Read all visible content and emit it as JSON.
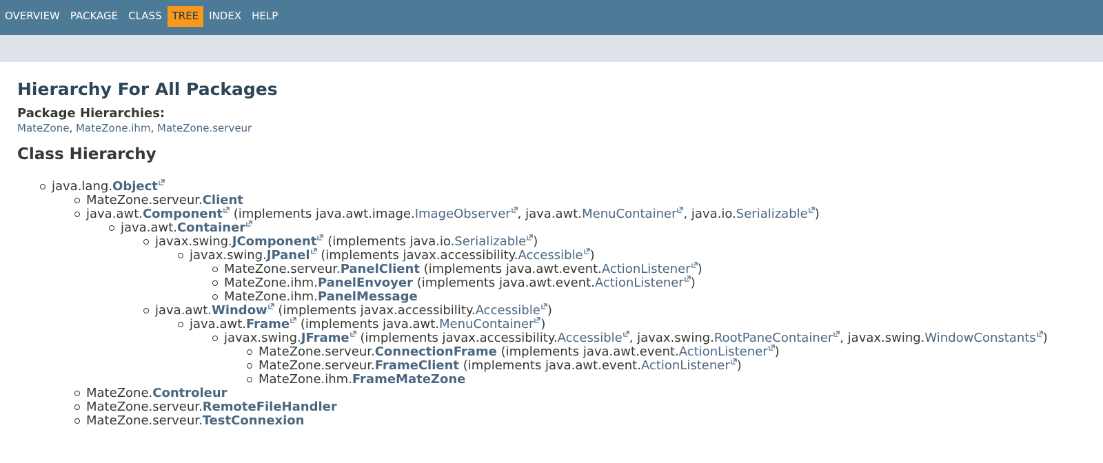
{
  "nav": {
    "items": [
      {
        "label": "OVERVIEW",
        "active": false
      },
      {
        "label": "PACKAGE",
        "active": false
      },
      {
        "label": "CLASS",
        "active": false
      },
      {
        "label": "TREE",
        "active": true
      },
      {
        "label": "INDEX",
        "active": false
      },
      {
        "label": "HELP",
        "active": false
      }
    ],
    "bar_color": "#4d7a97",
    "active_color": "#f8981d"
  },
  "page": {
    "title": "Hierarchy For All Packages",
    "package_hierarchies_label": "Package Hierarchies:",
    "packages": [
      "MateZone",
      "MateZone.ihm",
      "MateZone.serveur"
    ],
    "class_hierarchy_heading": "Class Hierarchy"
  },
  "tree": [
    {
      "level": 0,
      "parts": [
        {
          "t": "java.lang."
        },
        {
          "t": "Object",
          "cls": true,
          "ext": true
        }
      ]
    },
    {
      "level": 1,
      "parts": [
        {
          "t": "MateZone.serveur."
        },
        {
          "t": "Client",
          "cls": true
        }
      ]
    },
    {
      "level": 1,
      "parts": [
        {
          "t": "java.awt."
        },
        {
          "t": "Component",
          "cls": true,
          "ext": true
        },
        {
          "t": " (implements java.awt.image."
        },
        {
          "t": "ImageObserver",
          "lnk": true,
          "ext": true
        },
        {
          "t": ", java.awt."
        },
        {
          "t": "MenuContainer",
          "lnk": true,
          "ext": true
        },
        {
          "t": ", java.io."
        },
        {
          "t": "Serializable",
          "lnk": true,
          "ext": true
        },
        {
          "t": ")"
        }
      ]
    },
    {
      "level": 2,
      "parts": [
        {
          "t": "java.awt."
        },
        {
          "t": "Container",
          "cls": true,
          "ext": true
        }
      ]
    },
    {
      "level": 3,
      "parts": [
        {
          "t": "javax.swing."
        },
        {
          "t": "JComponent",
          "cls": true,
          "ext": true
        },
        {
          "t": " (implements java.io."
        },
        {
          "t": "Serializable",
          "lnk": true,
          "ext": true
        },
        {
          "t": ")"
        }
      ]
    },
    {
      "level": 4,
      "parts": [
        {
          "t": "javax.swing."
        },
        {
          "t": "JPanel",
          "cls": true,
          "ext": true
        },
        {
          "t": " (implements javax.accessibility."
        },
        {
          "t": "Accessible",
          "lnk": true,
          "ext": true
        },
        {
          "t": ")"
        }
      ]
    },
    {
      "level": 5,
      "parts": [
        {
          "t": "MateZone.serveur."
        },
        {
          "t": "PanelClient",
          "cls": true
        },
        {
          "t": " (implements java.awt.event."
        },
        {
          "t": "ActionListener",
          "lnk": true,
          "ext": true
        },
        {
          "t": ")"
        }
      ]
    },
    {
      "level": 5,
      "parts": [
        {
          "t": "MateZone.ihm."
        },
        {
          "t": "PanelEnvoyer",
          "cls": true
        },
        {
          "t": " (implements java.awt.event."
        },
        {
          "t": "ActionListener",
          "lnk": true,
          "ext": true
        },
        {
          "t": ")"
        }
      ]
    },
    {
      "level": 5,
      "parts": [
        {
          "t": "MateZone.ihm."
        },
        {
          "t": "PanelMessage",
          "cls": true
        }
      ]
    },
    {
      "level": 3,
      "parts": [
        {
          "t": "java.awt."
        },
        {
          "t": "Window",
          "cls": true,
          "ext": true
        },
        {
          "t": " (implements javax.accessibility."
        },
        {
          "t": "Accessible",
          "lnk": true,
          "ext": true
        },
        {
          "t": ")"
        }
      ]
    },
    {
      "level": 4,
      "parts": [
        {
          "t": "java.awt."
        },
        {
          "t": "Frame",
          "cls": true,
          "ext": true
        },
        {
          "t": " (implements java.awt."
        },
        {
          "t": "MenuContainer",
          "lnk": true,
          "ext": true
        },
        {
          "t": ")"
        }
      ]
    },
    {
      "level": 5,
      "parts": [
        {
          "t": "javax.swing."
        },
        {
          "t": "JFrame",
          "cls": true,
          "ext": true
        },
        {
          "t": " (implements javax.accessibility."
        },
        {
          "t": "Accessible",
          "lnk": true,
          "ext": true
        },
        {
          "t": ", javax.swing."
        },
        {
          "t": "RootPaneContainer",
          "lnk": true,
          "ext": true
        },
        {
          "t": ", javax.swing."
        },
        {
          "t": "WindowConstants",
          "lnk": true,
          "ext": true
        },
        {
          "t": ")"
        }
      ]
    },
    {
      "level": 6,
      "parts": [
        {
          "t": "MateZone.serveur."
        },
        {
          "t": "ConnectionFrame",
          "cls": true
        },
        {
          "t": " (implements java.awt.event."
        },
        {
          "t": "ActionListener",
          "lnk": true,
          "ext": true
        },
        {
          "t": ")"
        }
      ]
    },
    {
      "level": 6,
      "parts": [
        {
          "t": "MateZone.serveur."
        },
        {
          "t": "FrameClient",
          "cls": true
        },
        {
          "t": " (implements java.awt.event."
        },
        {
          "t": "ActionListener",
          "lnk": true,
          "ext": true
        },
        {
          "t": ")"
        }
      ]
    },
    {
      "level": 6,
      "parts": [
        {
          "t": "MateZone.ihm."
        },
        {
          "t": "FrameMateZone",
          "cls": true
        }
      ]
    },
    {
      "level": 1,
      "parts": [
        {
          "t": "MateZone."
        },
        {
          "t": "Controleur",
          "cls": true
        }
      ]
    },
    {
      "level": 1,
      "parts": [
        {
          "t": "MateZone.serveur."
        },
        {
          "t": "RemoteFileHandler",
          "cls": true
        }
      ]
    },
    {
      "level": 1,
      "parts": [
        {
          "t": "MateZone.serveur."
        },
        {
          "t": "TestConnexion",
          "cls": true
        }
      ]
    }
  ]
}
